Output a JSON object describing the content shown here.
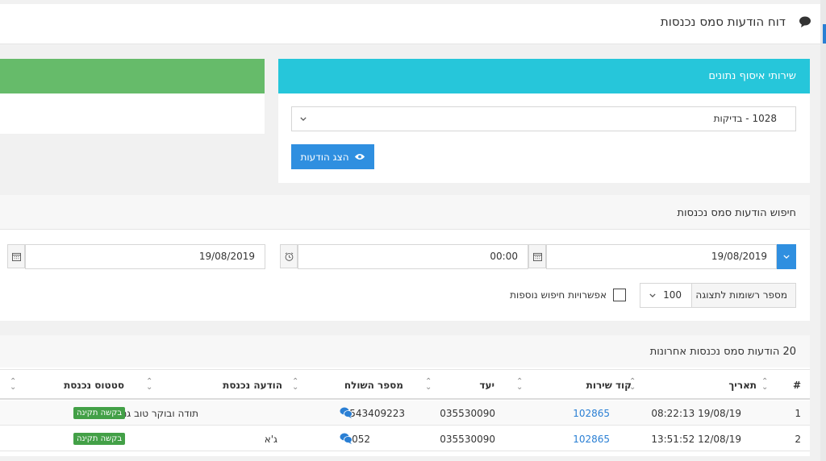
{
  "page": {
    "title": "דוח הודעות סמס נכנסות"
  },
  "services_panel": {
    "title": "שירותי איסוף נתונים",
    "selected_service": "1028 - בדיקות",
    "show_button": "הצג הודעות"
  },
  "search": {
    "title": "חיפוש הודעות סמס נכנסות",
    "from_date": "19/08/2019",
    "from_time": "00:00",
    "to_date": "19/08/2019",
    "records_label": "מספר רשומות לתצוגה",
    "records_value": "100",
    "more_options_label": "אפשרויות חיפוש נוספות"
  },
  "results": {
    "title": "20 הודעות סמס נכנסות אחרונות",
    "columns": [
      "#",
      "תאריך",
      "קוד שירות",
      "יעד",
      "מספר השולח",
      "הודעה נכנסת",
      "סטטוס נכנסת"
    ],
    "rows": [
      {
        "num": "1",
        "date": "19/08/19 08:22:13",
        "service": "102865",
        "target": "035530090",
        "sender": "0543409223",
        "message": "תודה ובוקר טוב גם לכ",
        "status": "בקשה תקינה"
      },
      {
        "num": "2",
        "date": "12/08/19 13:51:52",
        "service": "102865",
        "target": "035530090",
        "sender": "052",
        "message": "ג'א",
        "status": "בקשה תקינה"
      }
    ]
  },
  "colors": {
    "accent": "#2f8fe0",
    "cyan_header": "#26c6da",
    "green_header": "#66bb6a",
    "status_green": "#43a047"
  }
}
